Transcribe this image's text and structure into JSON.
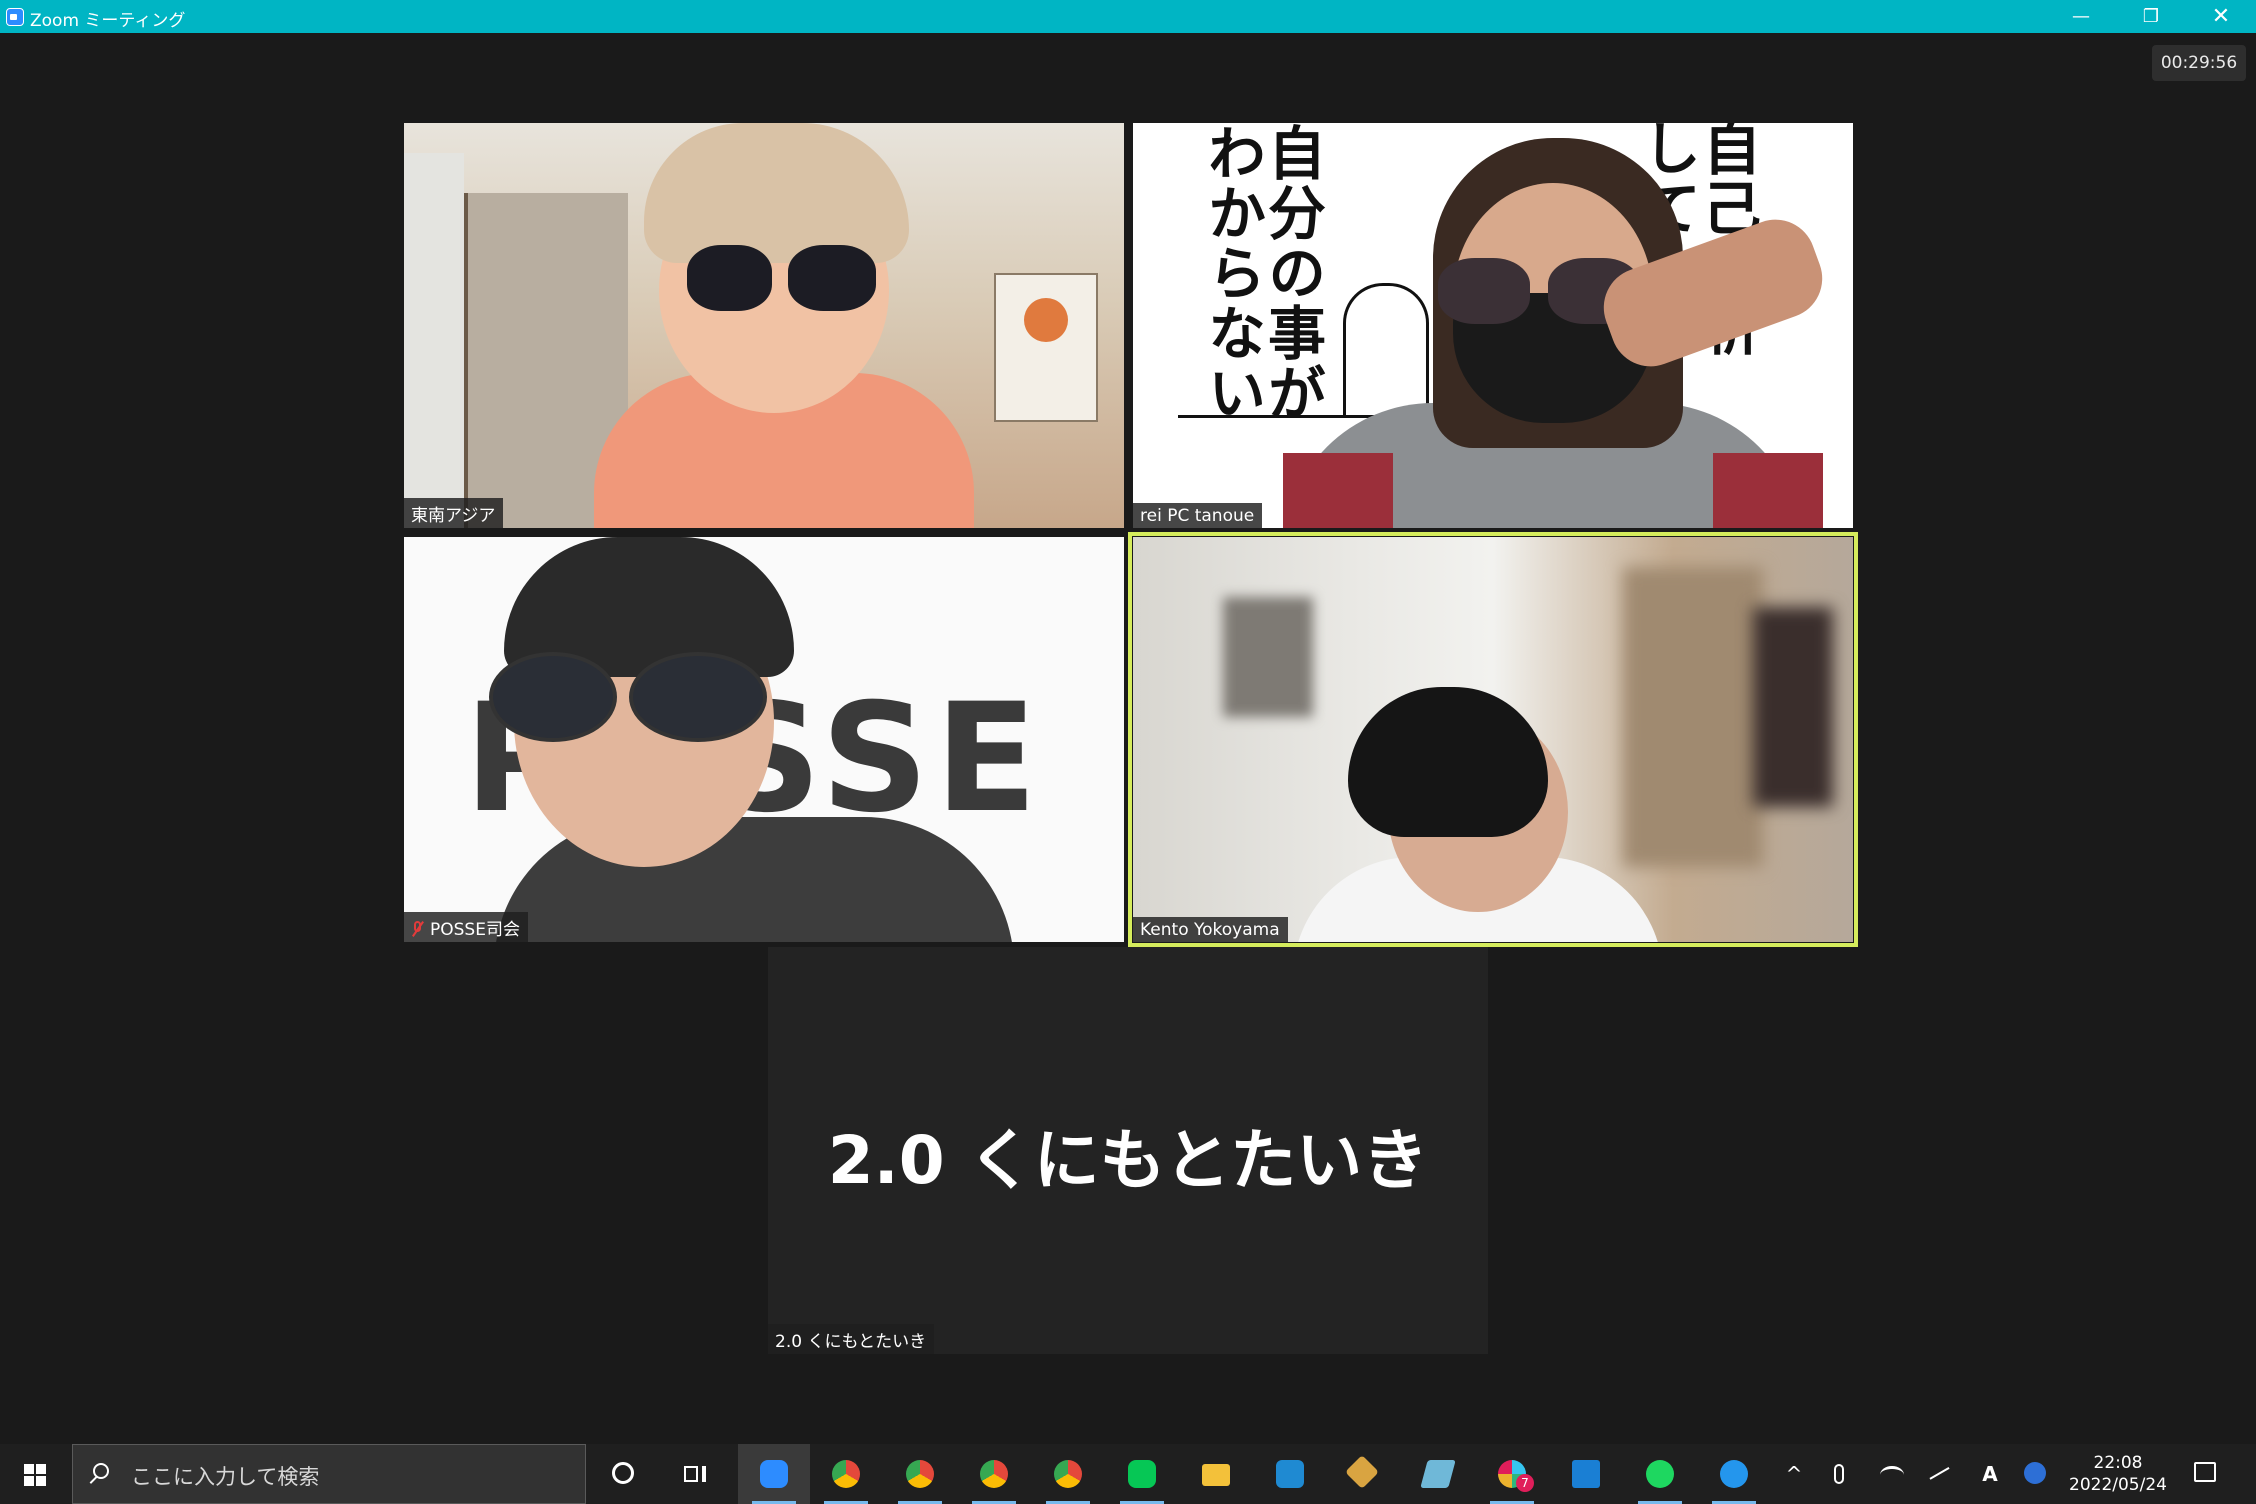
{
  "window": {
    "title": "Zoom ミーティング",
    "minimize": "—",
    "restore": "❐",
    "close": "✕"
  },
  "timer": "00:29:56",
  "participants": [
    {
      "name": "東南アジア",
      "muted": false
    },
    {
      "name": "rei PC tanoue",
      "muted": false,
      "background_text": [
        "自己分析",
        "して",
        "自分の事が",
        "わからない"
      ]
    },
    {
      "name": "POSSE司会",
      "muted": true,
      "background_text": "POSSE"
    },
    {
      "name": "Kento Yokoyama",
      "muted": false,
      "active_speaker": true
    },
    {
      "name": "2.0 くにもとたいき",
      "muted": false,
      "video_off": true,
      "display_name": "2.0 くにもとたいき"
    }
  ],
  "taskbar": {
    "search_placeholder": "ここに入力して検索",
    "apps": [
      {
        "icon": "zoom-icon",
        "color": "#2d8cff",
        "active": true
      },
      {
        "icon": "chrome-icon",
        "color": "#e4483b"
      },
      {
        "icon": "chrome-icon",
        "color": "#36a852"
      },
      {
        "icon": "chrome-icon",
        "color": "#e4483b"
      },
      {
        "icon": "chrome-icon",
        "color": "#fbbc05"
      },
      {
        "icon": "line-icon",
        "color": "#06c755"
      },
      {
        "icon": "file-explorer-icon",
        "color": "#f3c13a"
      },
      {
        "icon": "vscode-icon",
        "color": "#1f8ad2"
      },
      {
        "icon": "git-icon",
        "color": "#d9a441"
      },
      {
        "icon": "notepad-icon",
        "color": "#6fb8d8"
      },
      {
        "icon": "slack-icon",
        "color": "#e8e8e8",
        "badge": "7"
      },
      {
        "icon": "store-icon",
        "color": "#1a7fd4"
      },
      {
        "icon": "spotify-icon",
        "color": "#1ed760"
      },
      {
        "icon": "docker-icon",
        "color": "#2496ed"
      }
    ],
    "tray": {
      "chevron": "^",
      "ime": "A",
      "time": "22:08",
      "date": "2022/05/24"
    }
  }
}
